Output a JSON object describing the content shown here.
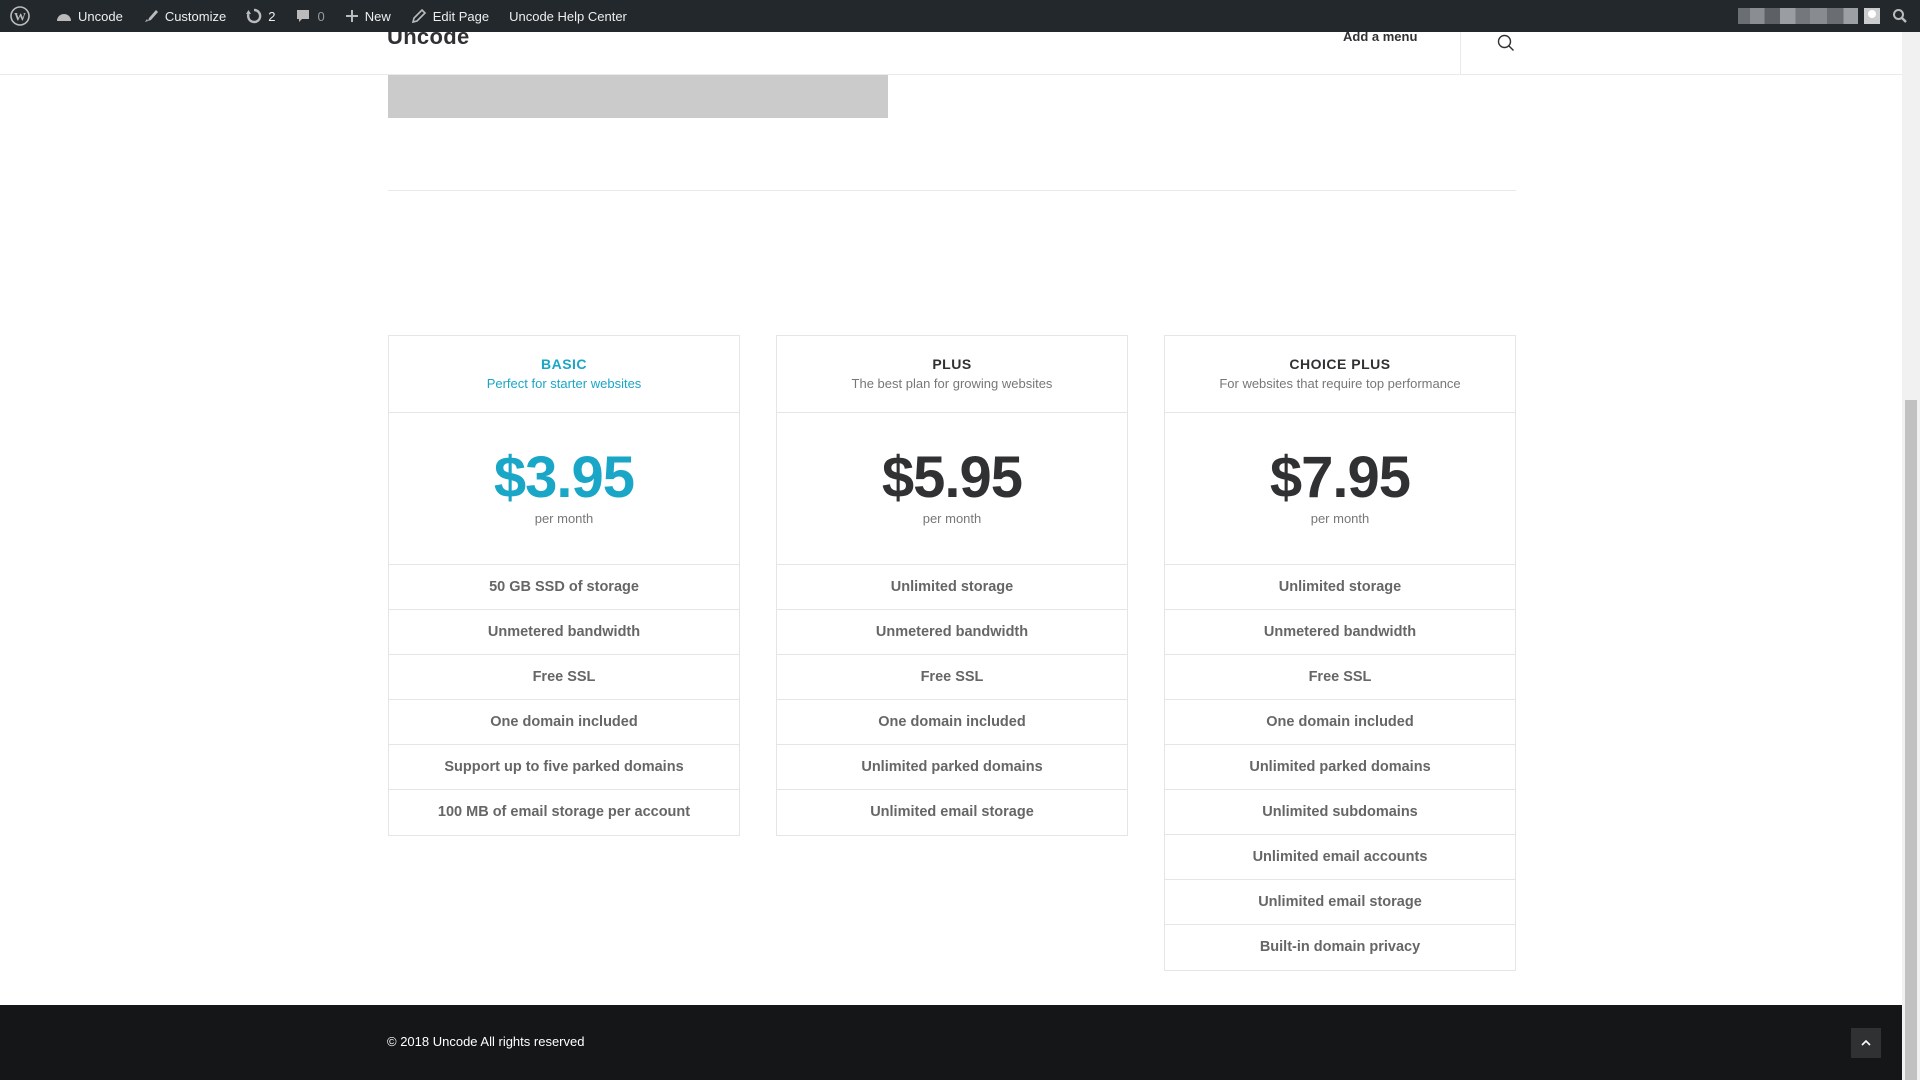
{
  "adminbar": {
    "site": "Uncode",
    "customize": "Customize",
    "updates": "2",
    "comments": "0",
    "new": "New",
    "edit_page": "Edit Page",
    "help": "Uncode Help Center"
  },
  "header": {
    "logo": "Uncode",
    "menu": "Add a menu"
  },
  "plans": [
    {
      "name": "BASIC",
      "subtitle": "Perfect for starter websites",
      "price": "$3.95",
      "period": "per month",
      "features": [
        "50 GB SSD of storage",
        "Unmetered bandwidth",
        "Free SSL",
        "One domain included",
        "Support up to five parked domains",
        "100 MB of email storage per account"
      ]
    },
    {
      "name": "PLUS",
      "subtitle": "The best plan for growing websites",
      "price": "$5.95",
      "period": "per month",
      "features": [
        "Unlimited storage",
        "Unmetered bandwidth",
        "Free SSL",
        "One domain included",
        "Unlimited parked domains",
        "Unlimited email storage"
      ]
    },
    {
      "name": "CHOICE PLUS",
      "subtitle": "For websites that require top performance",
      "price": "$7.95",
      "period": "per month",
      "features": [
        "Unlimited storage",
        "Unmetered bandwidth",
        "Free SSL",
        "One domain included",
        "Unlimited parked domains",
        "Unlimited subdomains",
        "Unlimited email accounts",
        "Unlimited email storage",
        "Built-in domain privacy"
      ]
    }
  ],
  "footer": {
    "copyright": "© 2018 Uncode All rights reserved"
  },
  "colors": {
    "accent": "#1aa6c7",
    "adminbar": "#23282d",
    "footer": "#141618"
  }
}
